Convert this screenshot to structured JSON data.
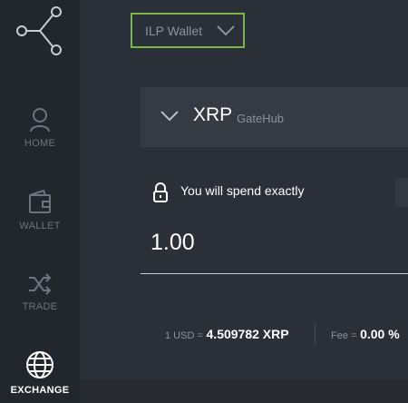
{
  "sidebar": {
    "items": [
      {
        "label": "HOME",
        "icon": "user-icon",
        "active": false
      },
      {
        "label": "WALLET",
        "icon": "wallet-icon",
        "active": false
      },
      {
        "label": "TRADE",
        "icon": "shuffle-icon",
        "active": false
      },
      {
        "label": "EXCHANGE",
        "icon": "globe-icon",
        "active": true
      }
    ]
  },
  "header": {
    "wallet_select": "ILP Wallet"
  },
  "asset": {
    "code": "XRP",
    "issuer": "GateHub"
  },
  "spend": {
    "label": "You will spend exactly",
    "amount": "1.00"
  },
  "rate": {
    "base_label": "1 USD =",
    "rate_value": "4.509782 XRP",
    "fee_label": "Fee =",
    "fee_value": "0.00 %"
  },
  "colors": {
    "accent_green": "#7bb84a",
    "background": "#2b2f38",
    "sidebar": "#22262d"
  }
}
